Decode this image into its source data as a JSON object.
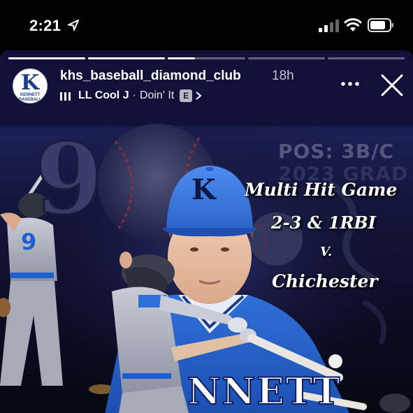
{
  "status_bar": {
    "time": "2:21",
    "icons": [
      "location-arrow-icon",
      "cellular-signal-icon",
      "wifi-icon",
      "battery-icon"
    ]
  },
  "story": {
    "progress_segments": [
      1,
      1,
      0.35,
      0,
      0
    ],
    "header": {
      "avatar_letter": "K",
      "avatar_text": "KENNETT BASEBALL",
      "username": "khs_baseball_diamond_club",
      "time_ago": "18h",
      "music": {
        "artist": "LL Cool J",
        "separator": "·",
        "title": "Doin' It",
        "explicit_badge": "E",
        "icon": "music-bars-icon"
      },
      "more_icon": "more-horizontal-icon",
      "close_icon": "close-icon"
    },
    "graphic": {
      "jersey_number_big": "9",
      "pos_line": "POS: 3B/C",
      "grad_line": "2023 GRAD",
      "caption": [
        "Multi Hit Game",
        "2-3 & 1RBI",
        "V.",
        "Chichester"
      ],
      "back_jersey_number": "9",
      "cap_letter": "K",
      "front_jersey_text": "NNETT"
    },
    "colors": {
      "background": "#14173e",
      "accent_blue": "#2f6fd8",
      "text": "#ffffff"
    }
  }
}
